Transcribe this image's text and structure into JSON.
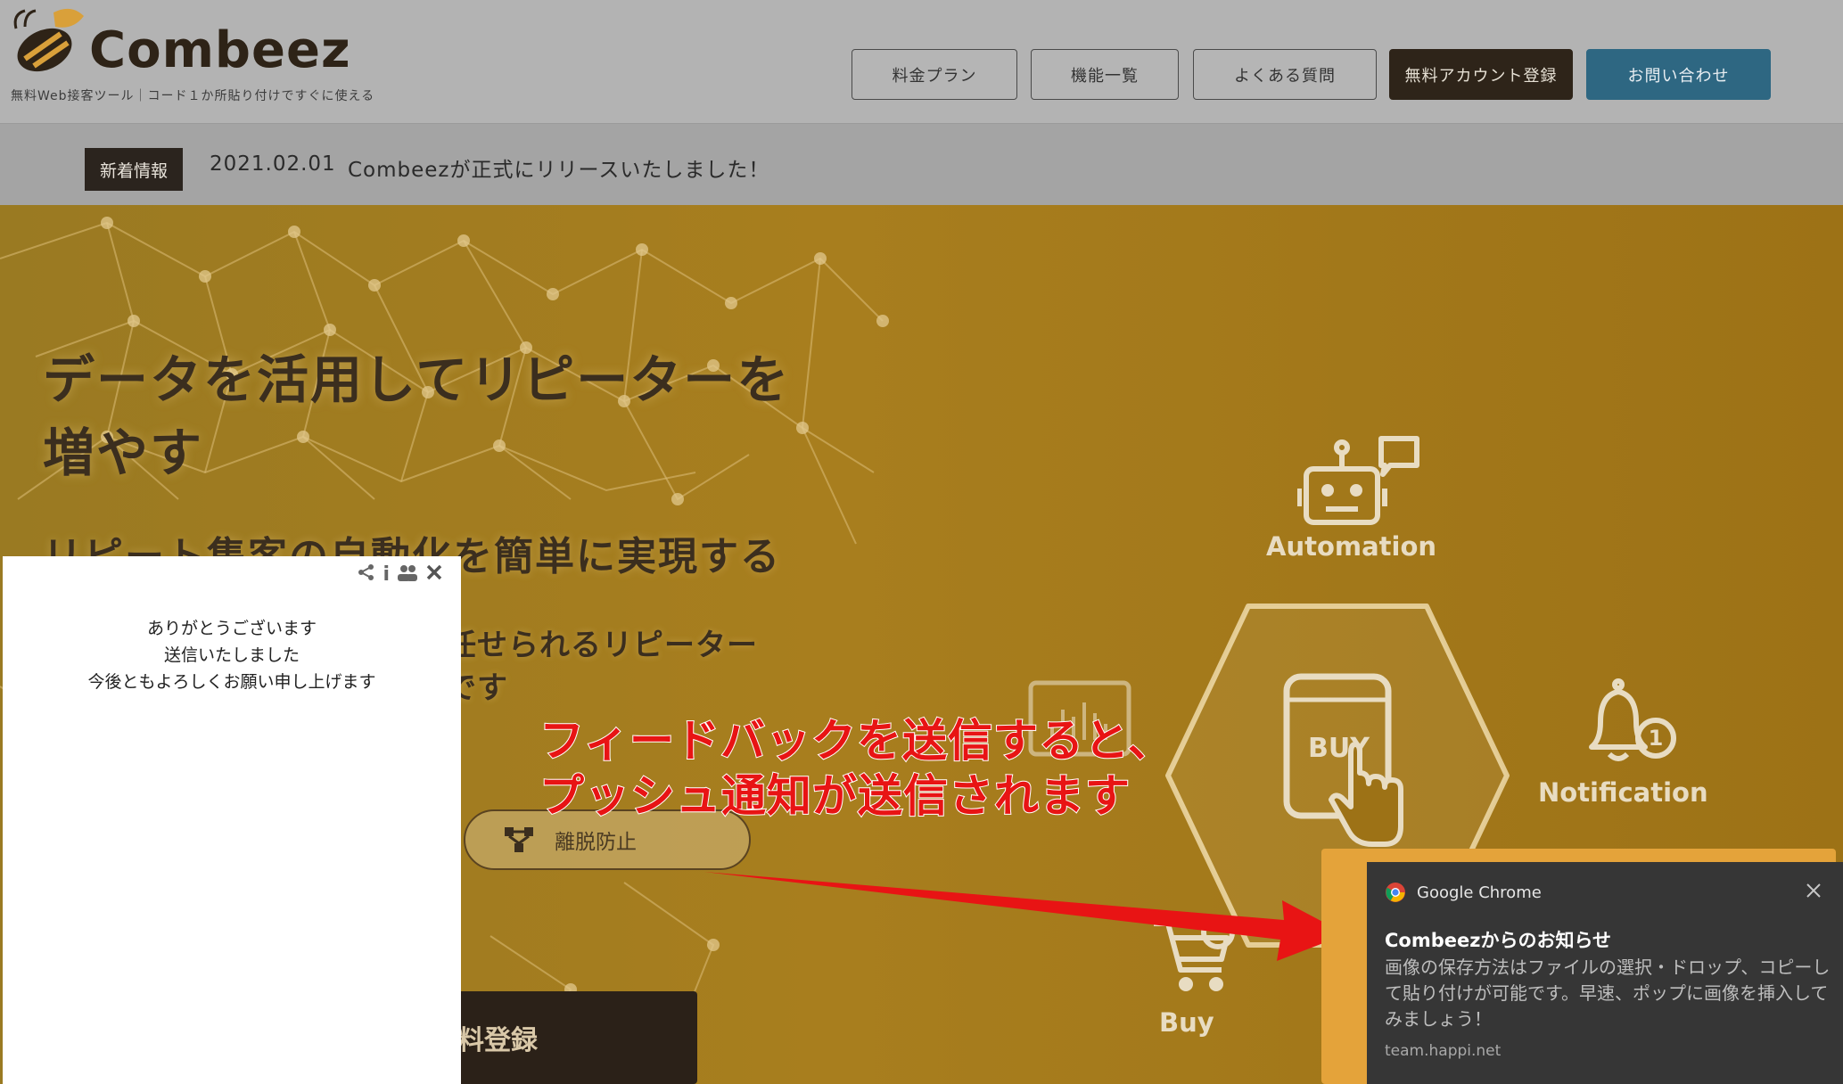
{
  "header": {
    "logo_text": "Combeez",
    "tagline": "無料Web接客ツール｜コード１か所貼り付けですぐに使える",
    "nav": [
      {
        "label": "料金プラン"
      },
      {
        "label": "機能一覧"
      },
      {
        "label": "よくある質問"
      },
      {
        "label": "無料アカウント登録"
      },
      {
        "label": "お問い合わせ"
      }
    ]
  },
  "news": {
    "badge": "新着情報",
    "date": "2021.02.01",
    "text": "Combeezが正式にリリースいたしました！"
  },
  "hero": {
    "headline_line1": "データを活用してリピーターを",
    "headline_line2": "増やす",
    "subheadline": "リピート集客の自動化を簡単に実現する",
    "desc_line1": "任せられるリピーター",
    "desc_line2": "です",
    "pill_label": "離脱防止",
    "dark_button_label": "料登録",
    "services": {
      "automation": "Automation",
      "notification": "Notification",
      "buy": "Buy",
      "buy_device": "BUY"
    }
  },
  "annotation": {
    "line1": "フィードバックを送信すると、",
    "line2": "プッシュ通知が送信されます"
  },
  "popup": {
    "tools": {
      "info": "i"
    },
    "message": [
      "ありがとうございます",
      "送信いたしました",
      "今後ともよろしくお願い申し上げます"
    ]
  },
  "toast": {
    "app": "Google Chrome",
    "title": "Combeezからのお知らせ",
    "body": "画像の保存方法はファイルの選択・ドロップ、コピーして貼り付けが可能です。早速、ポップに画像を挿入してみましょう！",
    "source": "team.happi.net"
  },
  "colors": {
    "brand_dark": "#2e2419",
    "brand_blue": "#2e6782",
    "hero_gold": "#a87e1e",
    "annotation_red": "#e81414"
  }
}
